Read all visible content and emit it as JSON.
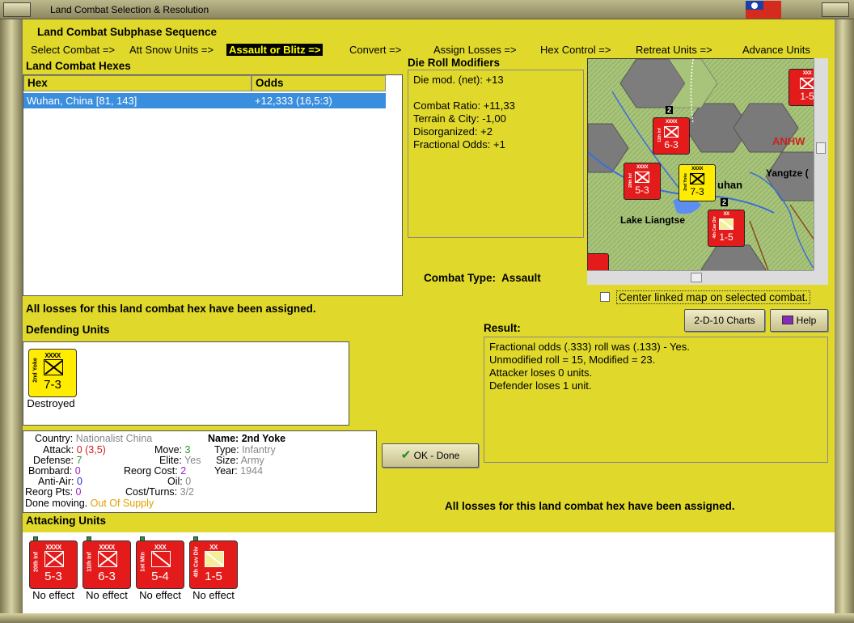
{
  "window": {
    "title": "Land Combat Selection & Resolution"
  },
  "phase": {
    "title": "Land Combat Subphase Sequence",
    "steps": [
      "Select Combat =>",
      "Att Snow Units =>",
      "Assault or Blitz =>",
      "Convert =>",
      "Assign Losses =>",
      "Hex Control =>",
      "Retreat Units =>",
      "Advance Units"
    ],
    "active_index": 2
  },
  "hexes": {
    "label": "Land Combat Hexes",
    "col_hex": "Hex",
    "col_odds": "Odds",
    "rows": [
      {
        "hex": "Wuhan, China [81, 143]",
        "odds": "+12,333 (16,5:3)"
      }
    ]
  },
  "die": {
    "label": "Die Roll Modifiers",
    "lines": [
      "Die mod. (net): +13",
      "",
      "Combat Ratio: +11,33",
      "Terrain & City: -1,00",
      "Disorganized: +2",
      "Fractional Odds: +1"
    ]
  },
  "map": {
    "labels": {
      "anhw": "ANHW",
      "yangtze": "Yangtze (",
      "wuhan": "uhan",
      "lake": "Lake Liangtse"
    },
    "stack_count_1": "2",
    "stack_count_2": "2",
    "units": [
      {
        "size": "XXXX",
        "name": "11th Inf",
        "str": "6-3"
      },
      {
        "size": "XXXX",
        "name": "20th Inf",
        "str": "5-3"
      },
      {
        "size": "XXXX",
        "name": "2nd Yoke",
        "str": "7-3"
      },
      {
        "size": "XX",
        "name": "4th Cav Div",
        "str": "1-5"
      },
      {
        "size": "XXX",
        "name": "",
        "str": "1-5"
      }
    ]
  },
  "combat_type": {
    "label": "Combat Type:",
    "value": "Assault"
  },
  "center_map": {
    "label": "Center linked map on selected combat."
  },
  "buttons": {
    "charts": "2-D-10 Charts",
    "help": "Help",
    "ok": "OK - Done"
  },
  "losses_msg": "All losses for this land combat hex have been assigned.",
  "defending": {
    "label": "Defending Units",
    "units": [
      {
        "size": "XXXX",
        "name": "2nd Yoke",
        "str": "7-3",
        "status": "Destroyed"
      }
    ]
  },
  "result": {
    "label": "Result:",
    "lines": [
      "Fractional odds (.333) roll was (.133)  - Yes.",
      "Unmodified roll = 15, Modified = 23.",
      "Attacker loses 0 units.",
      "Defender loses 1 unit."
    ]
  },
  "info": {
    "country_label": "Country:",
    "country": "Nationalist China",
    "attack_label": "Attack:",
    "attack": "0",
    "attack_extra": "(3,5)",
    "defense_label": "Defense:",
    "defense": "7",
    "bombard_label": "Bombard:",
    "bombard": "0",
    "antiair_label": "Anti-Air:",
    "antiair": "0",
    "reorg_label": "Reorg Pts:",
    "reorg": "0",
    "done_label": "Done moving.",
    "done": "Out Of Supply",
    "move_label": "Move:",
    "move": "3",
    "elite_label": "Elite:",
    "elite": "Yes",
    "reorgcost_label": "Reorg Cost:",
    "reorgcost": "2",
    "oil_label": "Oil:",
    "oil": "0",
    "costturns_label": "Cost/Turns:",
    "costturns": "3/2",
    "name_label": "Name:",
    "name": "2nd Yoke",
    "type_label": "Type:",
    "type": "Infantry",
    "size_label": "Size:",
    "size": "Army",
    "year_label": "Year:",
    "year": "1944"
  },
  "attacking": {
    "label": "Attacking Units",
    "units": [
      {
        "size": "XXXX",
        "name": "20th Inf",
        "str": "5-3",
        "status": "No effect"
      },
      {
        "size": "XXXX",
        "name": "11th Inf",
        "str": "6-3",
        "status": "No effect"
      },
      {
        "size": "XXX",
        "name": "1st Mtn",
        "str": "5-4",
        "status": "No effect"
      },
      {
        "size": "XX",
        "name": "4th Cav Div",
        "str": "1-5",
        "status": "No effect"
      }
    ]
  },
  "colors": {
    "panel": "#e0d92b",
    "counter_red": "#e41b1b",
    "counter_yellow": "#ffec00",
    "selection": "#3a8ede"
  }
}
